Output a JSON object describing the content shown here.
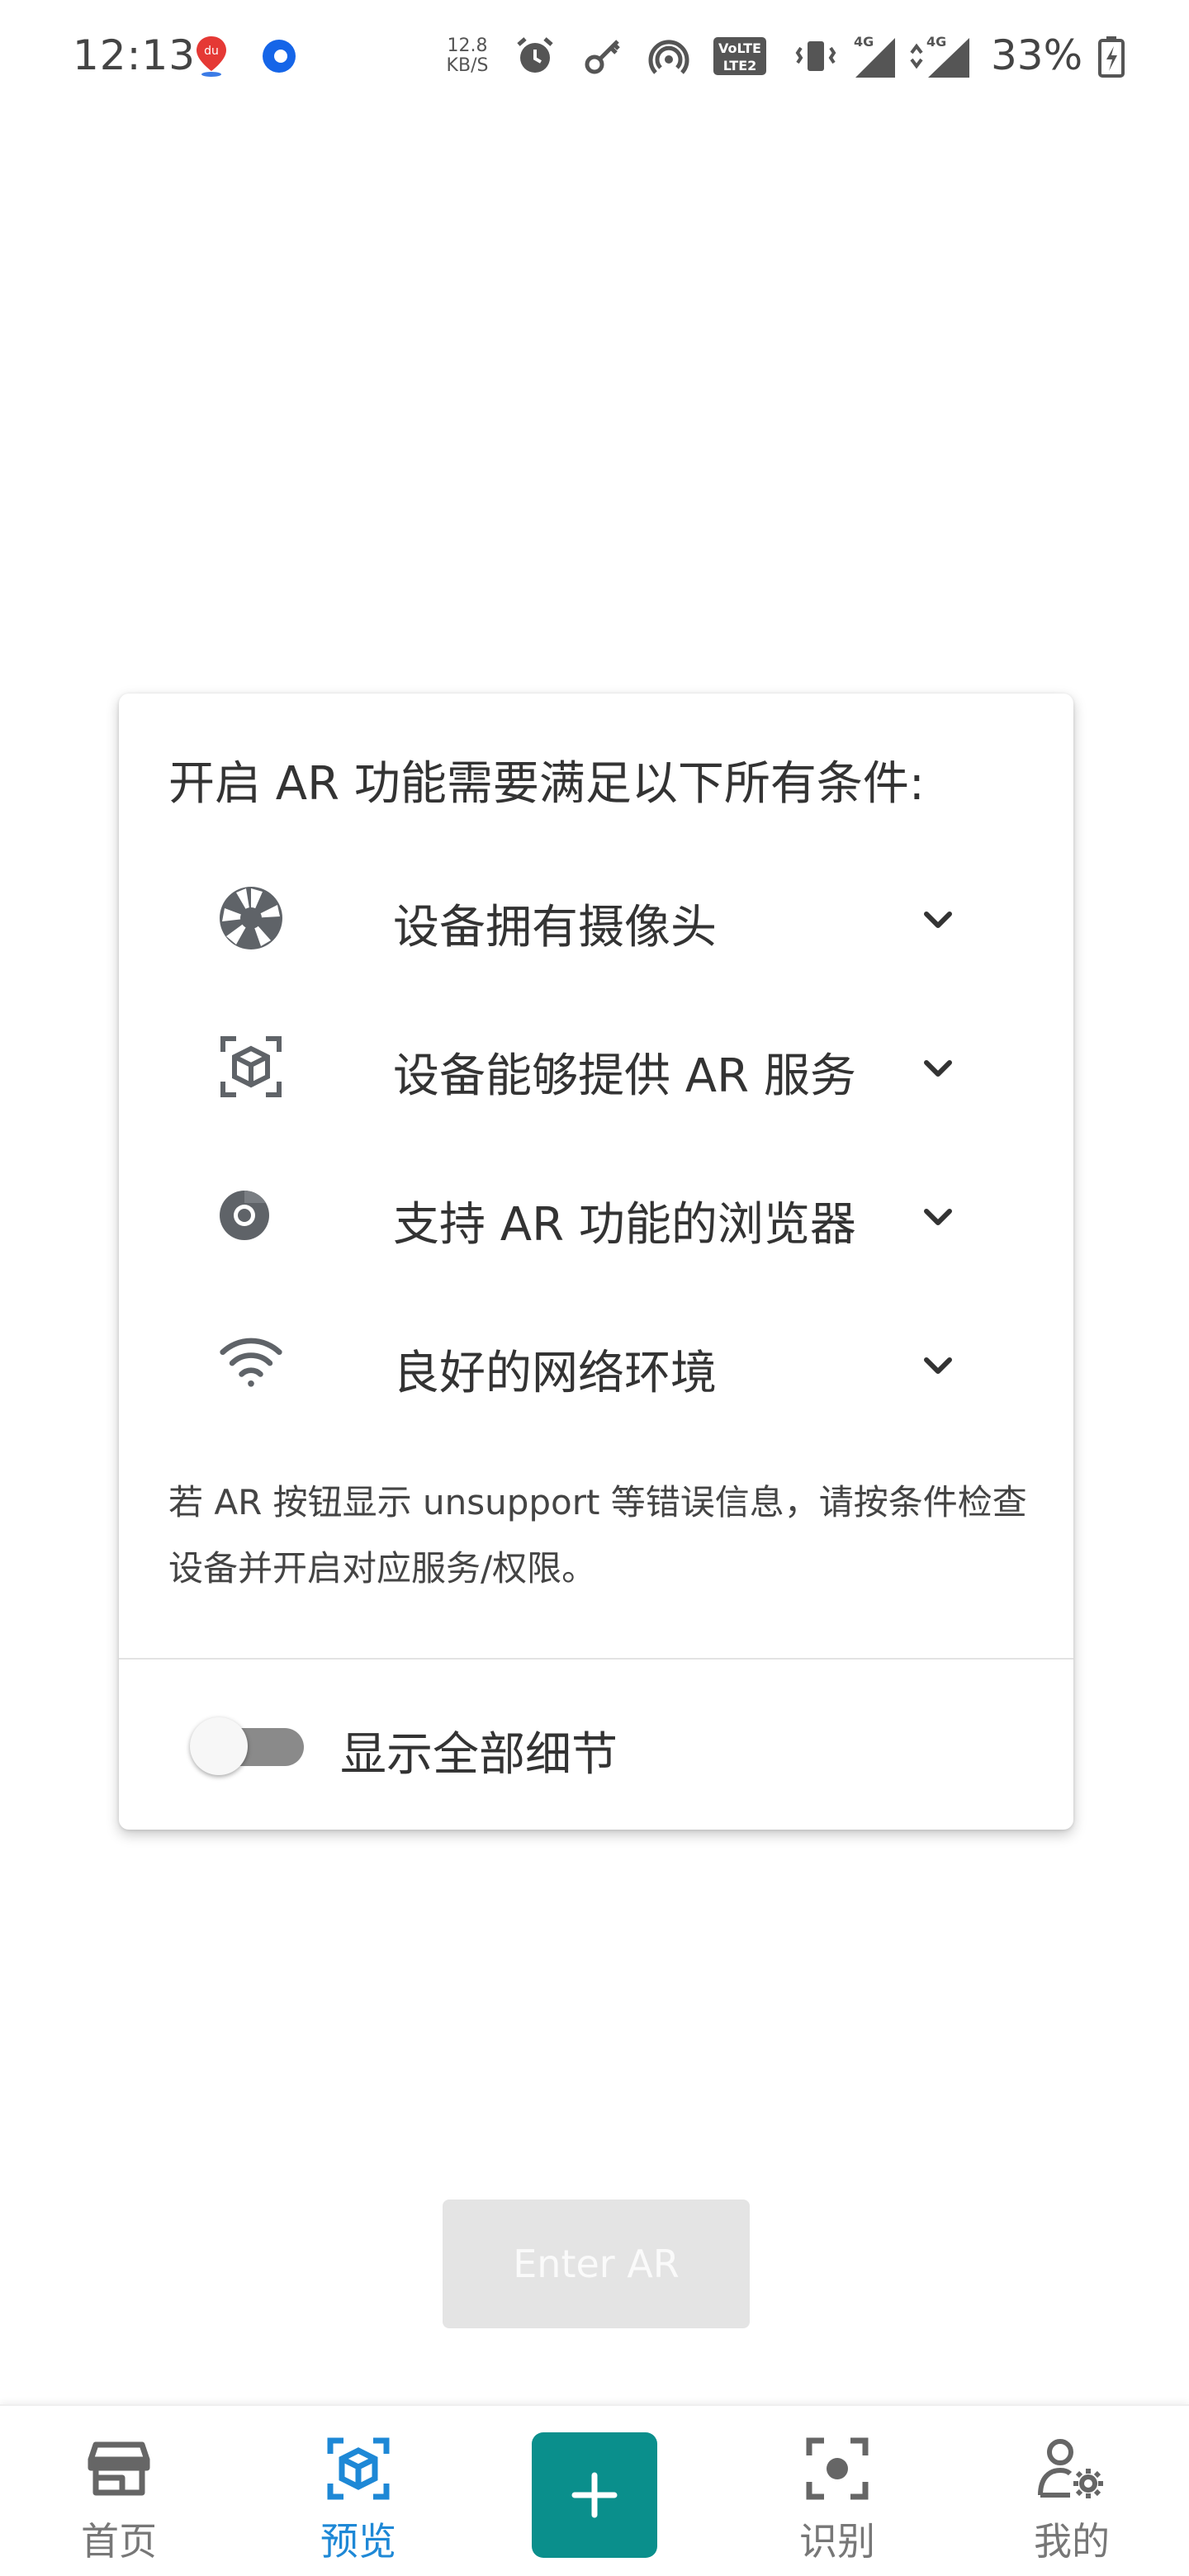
{
  "status_bar": {
    "time": "12:13",
    "speed_value": "12.8",
    "speed_unit": "KB/S",
    "battery": "33%",
    "icons": [
      "baidu-map-icon",
      "browser-icon",
      "alarm-icon",
      "key-icon",
      "hotspot-icon",
      "volte-icon",
      "vibrate-icon",
      "signal-4g-icon",
      "signal-4g-icon",
      "battery-charging-icon"
    ]
  },
  "card": {
    "title": "开启 AR 功能需要满足以下所有条件:",
    "requirements": [
      {
        "icon": "camera-aperture-icon",
        "label": "设备拥有摄像头"
      },
      {
        "icon": "ar-cube-icon",
        "label": "设备能够提供 AR 服务"
      },
      {
        "icon": "chrome-browser-icon",
        "label": "支持 AR 功能的浏览器"
      },
      {
        "icon": "wifi-icon",
        "label": "良好的网络环境"
      }
    ],
    "note": "若 AR 按钮显示 unsupport 等错误信息，请按条件检查设备并开启对应服务/权限。",
    "toggle_label": "显示全部细节",
    "toggle_on": false
  },
  "enter_ar_label": "Enter AR",
  "nav": {
    "items": [
      {
        "label": "首页",
        "icon": "store-icon"
      },
      {
        "label": "预览",
        "icon": "ar-cube-icon",
        "active": true
      },
      {
        "label": "",
        "icon": "plus-icon"
      },
      {
        "label": "识别",
        "icon": "scan-icon"
      },
      {
        "label": "我的",
        "icon": "user-settings-icon"
      }
    ]
  },
  "colors": {
    "accent": "#1e88d6",
    "add_button": "#0a8f8c",
    "toggle_track": "#8a8a8a"
  }
}
